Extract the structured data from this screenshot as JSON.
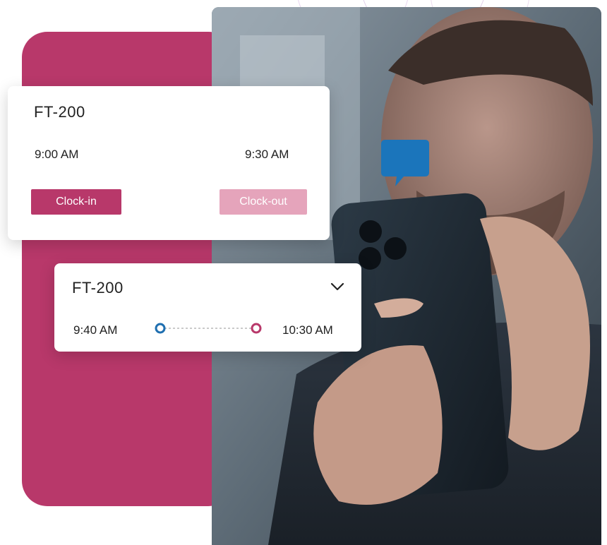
{
  "card_primary": {
    "title": "FT-200",
    "start_time": "9:00 AM",
    "end_time": "9:30 AM",
    "clock_in_label": "Clock-in",
    "clock_out_label": "Clock-out"
  },
  "card_secondary": {
    "title": "FT-200",
    "start_time": "9:40 AM",
    "end_time": "10:30 AM",
    "icons": {
      "expand": "chevron-down-icon"
    }
  },
  "icons": {
    "chat": "chat-bubble-icon"
  },
  "colors": {
    "accent": "#b8386a",
    "accent_light": "#e5a4bb",
    "timeline_start": "#1f6fb0",
    "timeline_end": "#b8386a",
    "chat_blue": "#1b75bb"
  }
}
